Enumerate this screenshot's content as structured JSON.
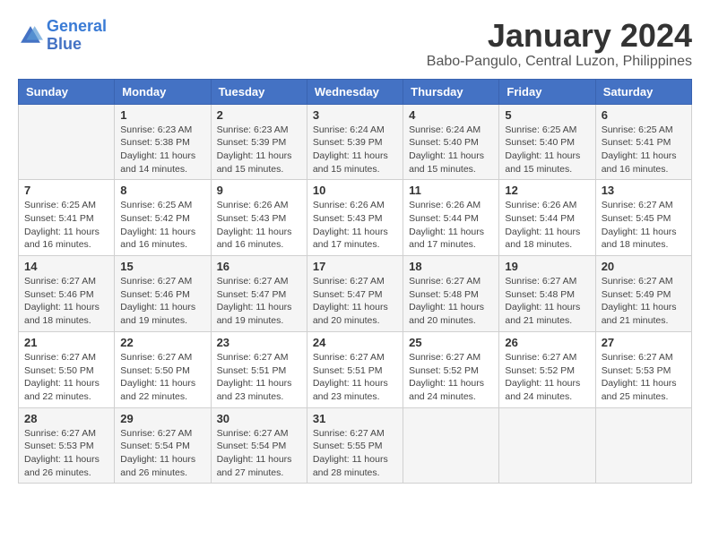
{
  "logo": {
    "text_general": "General",
    "text_blue": "Blue"
  },
  "title": "January 2024",
  "subtitle": "Babo-Pangulo, Central Luzon, Philippines",
  "days_header": [
    "Sunday",
    "Monday",
    "Tuesday",
    "Wednesday",
    "Thursday",
    "Friday",
    "Saturday"
  ],
  "weeks": [
    [
      {
        "day": "",
        "info": ""
      },
      {
        "day": "1",
        "info": "Sunrise: 6:23 AM\nSunset: 5:38 PM\nDaylight: 11 hours and 14 minutes."
      },
      {
        "day": "2",
        "info": "Sunrise: 6:23 AM\nSunset: 5:39 PM\nDaylight: 11 hours and 15 minutes."
      },
      {
        "day": "3",
        "info": "Sunrise: 6:24 AM\nSunset: 5:39 PM\nDaylight: 11 hours and 15 minutes."
      },
      {
        "day": "4",
        "info": "Sunrise: 6:24 AM\nSunset: 5:40 PM\nDaylight: 11 hours and 15 minutes."
      },
      {
        "day": "5",
        "info": "Sunrise: 6:25 AM\nSunset: 5:40 PM\nDaylight: 11 hours and 15 minutes."
      },
      {
        "day": "6",
        "info": "Sunrise: 6:25 AM\nSunset: 5:41 PM\nDaylight: 11 hours and 16 minutes."
      }
    ],
    [
      {
        "day": "7",
        "info": "Sunrise: 6:25 AM\nSunset: 5:41 PM\nDaylight: 11 hours and 16 minutes."
      },
      {
        "day": "8",
        "info": "Sunrise: 6:25 AM\nSunset: 5:42 PM\nDaylight: 11 hours and 16 minutes."
      },
      {
        "day": "9",
        "info": "Sunrise: 6:26 AM\nSunset: 5:43 PM\nDaylight: 11 hours and 16 minutes."
      },
      {
        "day": "10",
        "info": "Sunrise: 6:26 AM\nSunset: 5:43 PM\nDaylight: 11 hours and 17 minutes."
      },
      {
        "day": "11",
        "info": "Sunrise: 6:26 AM\nSunset: 5:44 PM\nDaylight: 11 hours and 17 minutes."
      },
      {
        "day": "12",
        "info": "Sunrise: 6:26 AM\nSunset: 5:44 PM\nDaylight: 11 hours and 18 minutes."
      },
      {
        "day": "13",
        "info": "Sunrise: 6:27 AM\nSunset: 5:45 PM\nDaylight: 11 hours and 18 minutes."
      }
    ],
    [
      {
        "day": "14",
        "info": "Sunrise: 6:27 AM\nSunset: 5:46 PM\nDaylight: 11 hours and 18 minutes."
      },
      {
        "day": "15",
        "info": "Sunrise: 6:27 AM\nSunset: 5:46 PM\nDaylight: 11 hours and 19 minutes."
      },
      {
        "day": "16",
        "info": "Sunrise: 6:27 AM\nSunset: 5:47 PM\nDaylight: 11 hours and 19 minutes."
      },
      {
        "day": "17",
        "info": "Sunrise: 6:27 AM\nSunset: 5:47 PM\nDaylight: 11 hours and 20 minutes."
      },
      {
        "day": "18",
        "info": "Sunrise: 6:27 AM\nSunset: 5:48 PM\nDaylight: 11 hours and 20 minutes."
      },
      {
        "day": "19",
        "info": "Sunrise: 6:27 AM\nSunset: 5:48 PM\nDaylight: 11 hours and 21 minutes."
      },
      {
        "day": "20",
        "info": "Sunrise: 6:27 AM\nSunset: 5:49 PM\nDaylight: 11 hours and 21 minutes."
      }
    ],
    [
      {
        "day": "21",
        "info": "Sunrise: 6:27 AM\nSunset: 5:50 PM\nDaylight: 11 hours and 22 minutes."
      },
      {
        "day": "22",
        "info": "Sunrise: 6:27 AM\nSunset: 5:50 PM\nDaylight: 11 hours and 22 minutes."
      },
      {
        "day": "23",
        "info": "Sunrise: 6:27 AM\nSunset: 5:51 PM\nDaylight: 11 hours and 23 minutes."
      },
      {
        "day": "24",
        "info": "Sunrise: 6:27 AM\nSunset: 5:51 PM\nDaylight: 11 hours and 23 minutes."
      },
      {
        "day": "25",
        "info": "Sunrise: 6:27 AM\nSunset: 5:52 PM\nDaylight: 11 hours and 24 minutes."
      },
      {
        "day": "26",
        "info": "Sunrise: 6:27 AM\nSunset: 5:52 PM\nDaylight: 11 hours and 24 minutes."
      },
      {
        "day": "27",
        "info": "Sunrise: 6:27 AM\nSunset: 5:53 PM\nDaylight: 11 hours and 25 minutes."
      }
    ],
    [
      {
        "day": "28",
        "info": "Sunrise: 6:27 AM\nSunset: 5:53 PM\nDaylight: 11 hours and 26 minutes."
      },
      {
        "day": "29",
        "info": "Sunrise: 6:27 AM\nSunset: 5:54 PM\nDaylight: 11 hours and 26 minutes."
      },
      {
        "day": "30",
        "info": "Sunrise: 6:27 AM\nSunset: 5:54 PM\nDaylight: 11 hours and 27 minutes."
      },
      {
        "day": "31",
        "info": "Sunrise: 6:27 AM\nSunset: 5:55 PM\nDaylight: 11 hours and 28 minutes."
      },
      {
        "day": "",
        "info": ""
      },
      {
        "day": "",
        "info": ""
      },
      {
        "day": "",
        "info": ""
      }
    ]
  ]
}
